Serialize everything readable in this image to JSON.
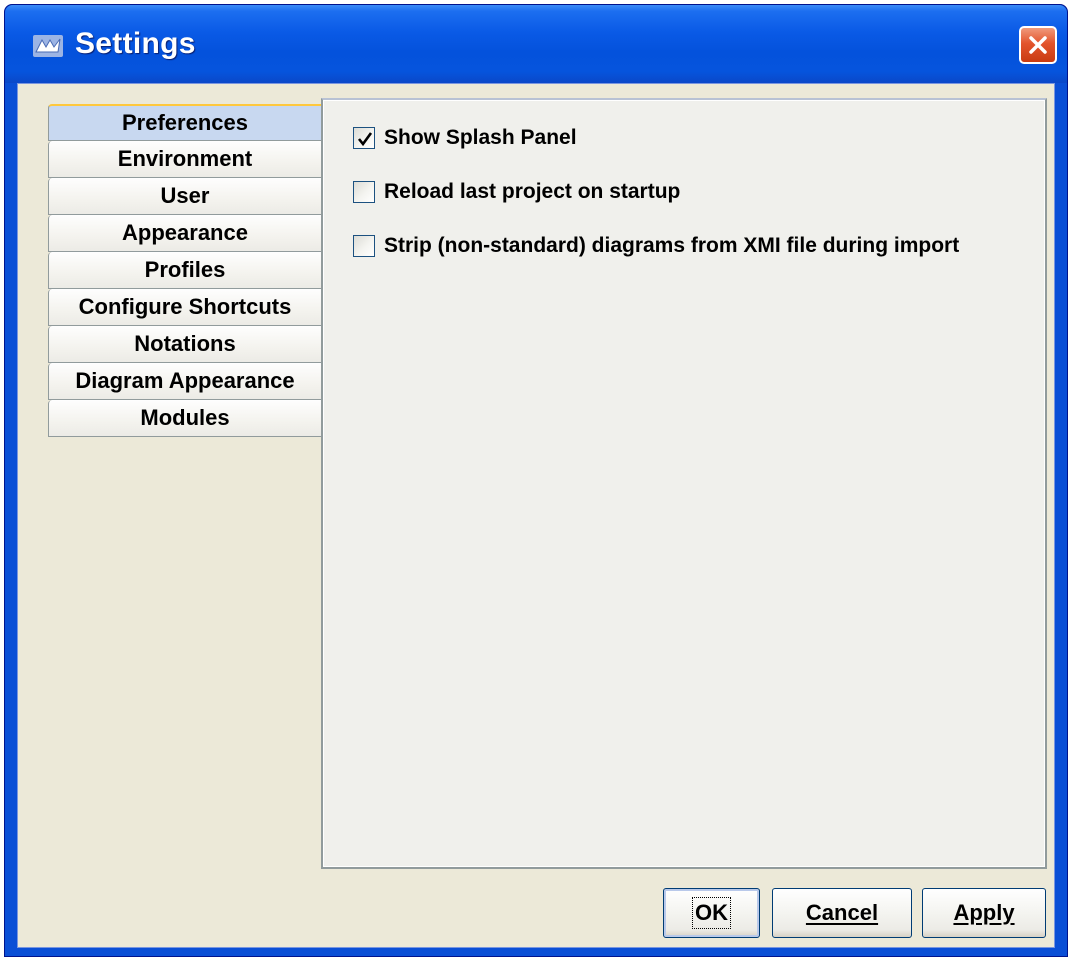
{
  "window": {
    "title": "Settings"
  },
  "tabs": [
    {
      "label": "Preferences",
      "selected": true
    },
    {
      "label": "Environment"
    },
    {
      "label": "User"
    },
    {
      "label": "Appearance"
    },
    {
      "label": "Profiles"
    },
    {
      "label": "Configure Shortcuts"
    },
    {
      "label": "Notations"
    },
    {
      "label": "Diagram Appearance"
    },
    {
      "label": "Modules"
    }
  ],
  "preferences": {
    "options": [
      {
        "label": "Show Splash Panel",
        "checked": true
      },
      {
        "label": "Reload last project on startup",
        "checked": false
      },
      {
        "label": "Strip (non-standard) diagrams from XMI file during import",
        "checked": false
      }
    ]
  },
  "buttons": {
    "ok": "OK",
    "cancel": "Cancel",
    "apply": "Apply"
  },
  "icons": {
    "app": "argouml-logo-icon",
    "close": "close-icon",
    "check": "checkmark-icon"
  },
  "colors": {
    "titlebar": "#0a5ae6",
    "close": "#e3542c",
    "client": "#ece9d8",
    "tab_selected": "#c8d8f0"
  }
}
